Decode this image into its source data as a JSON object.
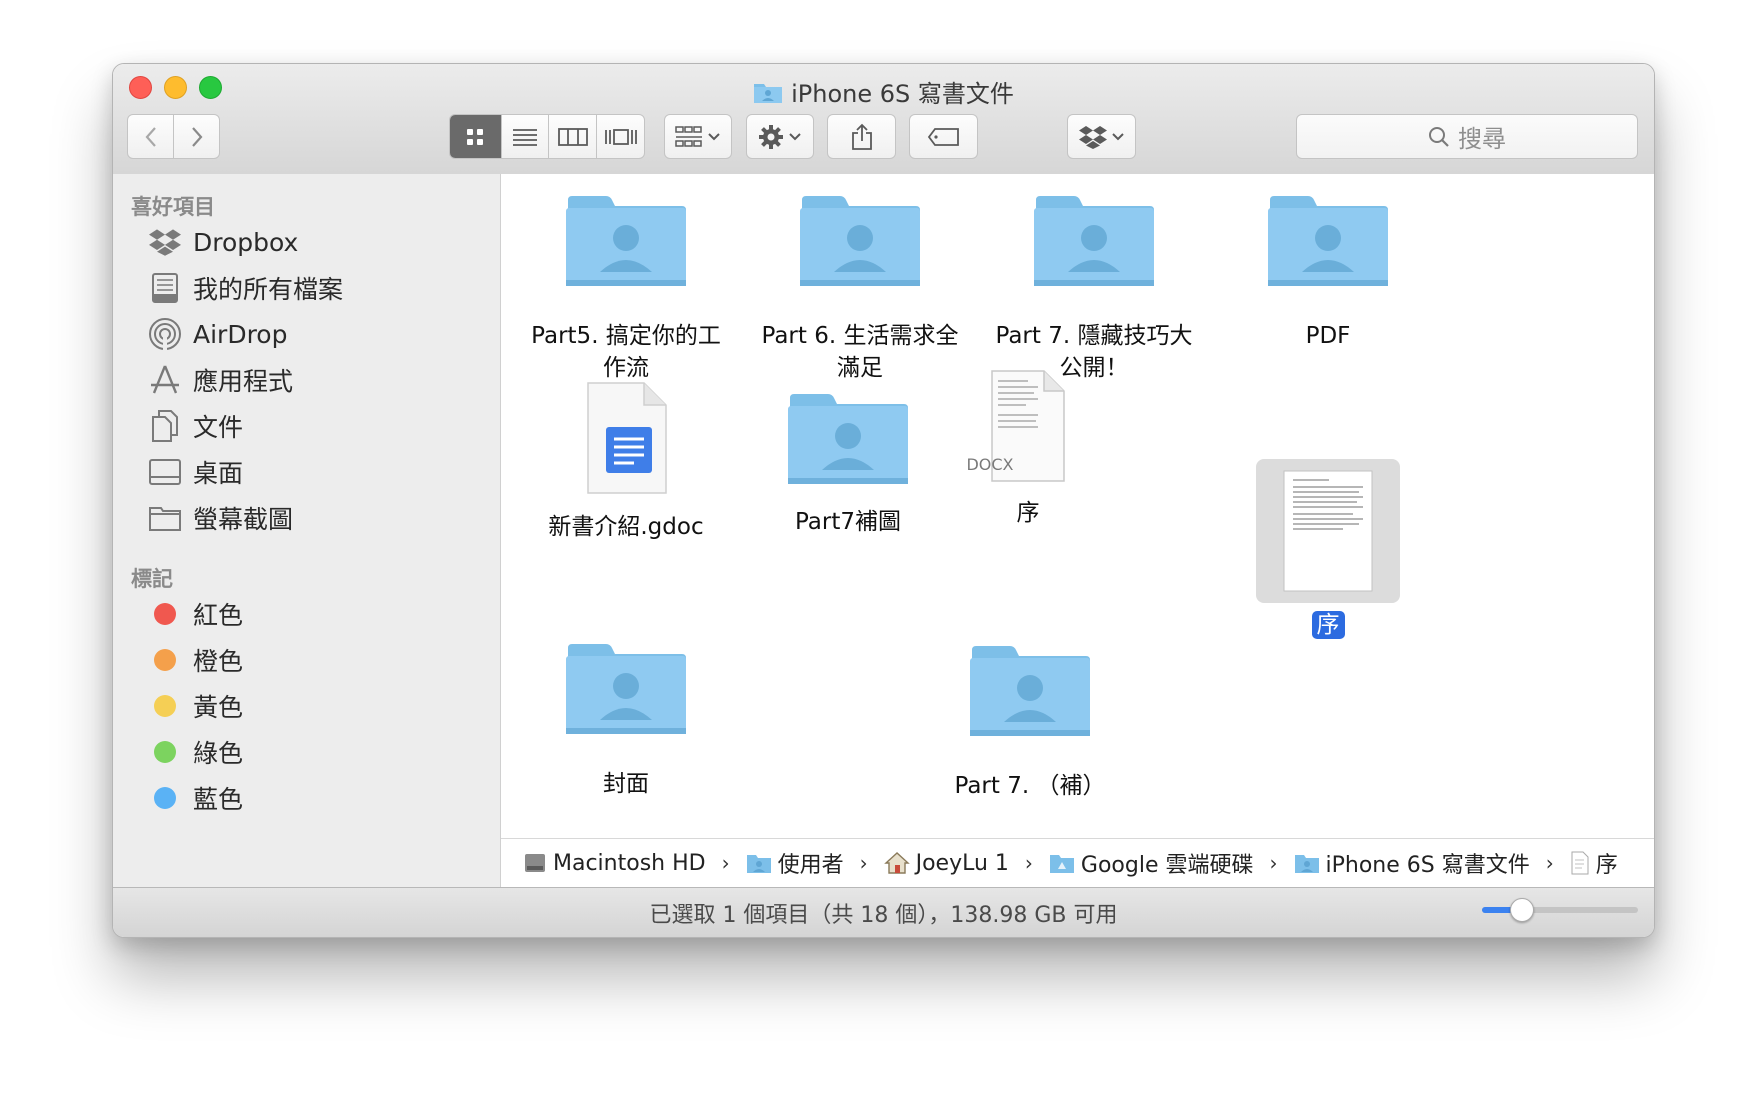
{
  "window": {
    "title": "iPhone 6S 寫書文件"
  },
  "toolbar": {
    "search_placeholder": "搜尋"
  },
  "sidebar": {
    "favorites_header": "喜好項目",
    "favorites": [
      {
        "label": "Dropbox",
        "icon": "dropbox-icon"
      },
      {
        "label": "我的所有檔案",
        "icon": "all-files-icon"
      },
      {
        "label": "AirDrop",
        "icon": "airdrop-icon"
      },
      {
        "label": "應用程式",
        "icon": "applications-icon"
      },
      {
        "label": "文件",
        "icon": "documents-icon"
      },
      {
        "label": "桌面",
        "icon": "desktop-icon"
      },
      {
        "label": "螢幕截圖",
        "icon": "folder-icon"
      }
    ],
    "tags_header": "標記",
    "tags": [
      {
        "label": "紅色",
        "color": "#f0584f"
      },
      {
        "label": "橙色",
        "color": "#f4a04b"
      },
      {
        "label": "黃色",
        "color": "#f5cf55"
      },
      {
        "label": "綠色",
        "color": "#7cd35f"
      },
      {
        "label": "藍色",
        "color": "#5ab2f5"
      }
    ]
  },
  "content": {
    "items": [
      {
        "label": "Part5. 搞定你的工作流",
        "icon": "shared-folder-icon"
      },
      {
        "label": "Part 6. 生活需求全滿足",
        "icon": "shared-folder-icon"
      },
      {
        "label": "Part 7. 隱藏技巧大公開！",
        "icon": "shared-folder-icon"
      },
      {
        "label": "PDF",
        "icon": "shared-folder-icon"
      },
      {
        "label": "新書介紹.gdoc",
        "icon": "google-doc-icon"
      },
      {
        "label": "Part7補圖",
        "icon": "shared-folder-icon"
      },
      {
        "label": "序",
        "icon": "docx-file-icon",
        "badge": "DOCX"
      },
      {
        "label": "序",
        "icon": "document-preview-icon",
        "selected": true
      },
      {
        "label": "封面",
        "icon": "shared-folder-icon"
      },
      {
        "label": "Part 7. （補）",
        "icon": "shared-folder-icon"
      }
    ]
  },
  "pathbar": {
    "crumbs": [
      {
        "label": "Macintosh HD",
        "icon": "hard-drive-icon"
      },
      {
        "label": "使用者",
        "icon": "folder-icon"
      },
      {
        "label": "JoeyLu 1",
        "icon": "home-icon"
      },
      {
        "label": "Google 雲端硬碟",
        "icon": "google-drive-folder-icon"
      },
      {
        "label": "iPhone 6S 寫書文件",
        "icon": "shared-folder-icon"
      },
      {
        "label": "序",
        "icon": "document-icon"
      }
    ]
  },
  "statusbar": {
    "text": "已選取 1 個項目（共 18 個），138.98 GB 可用",
    "icon_size_fraction": 0.25
  },
  "colors": {
    "folder": "#8cc9f0",
    "selection": "#2c6be0"
  }
}
